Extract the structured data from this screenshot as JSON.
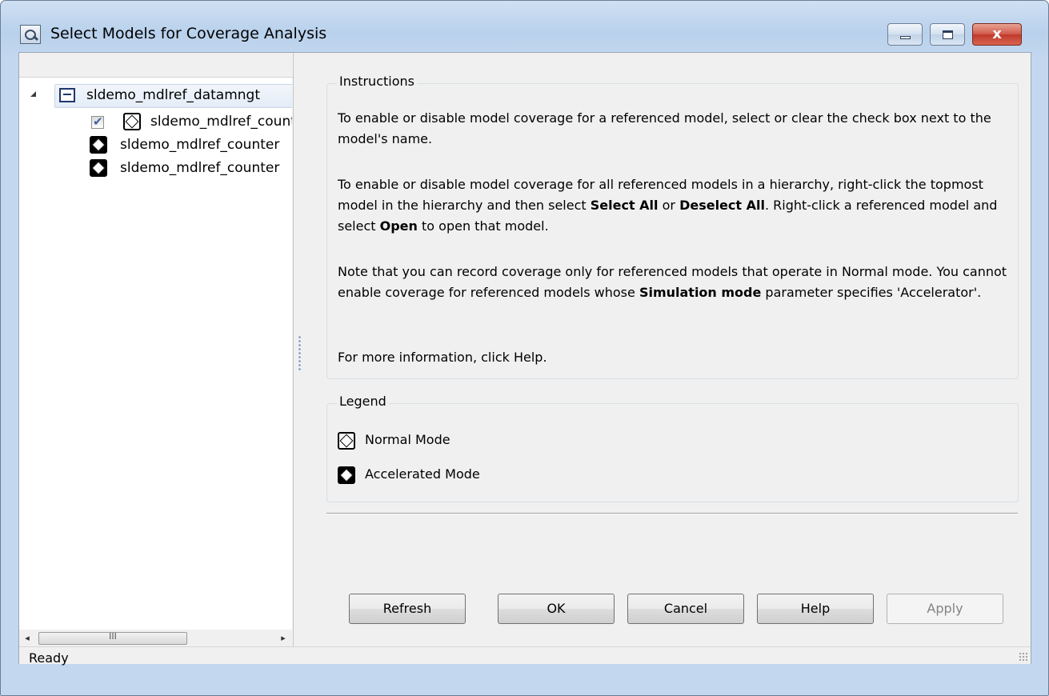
{
  "window": {
    "title": "Select Models for Coverage Analysis",
    "close_glyph": "x"
  },
  "tree": {
    "root": {
      "label": "sldemo_mdlref_datamngt",
      "icon": "subsystem-icon",
      "expanded": true
    },
    "children": [
      {
        "label": "sldemo_mdlref_counter",
        "icon": "normal-mode-icon",
        "checked": true
      },
      {
        "label": "sldemo_mdlref_counter",
        "icon": "accelerated-mode-icon"
      },
      {
        "label": "sldemo_mdlref_counter",
        "icon": "accelerated-mode-icon"
      }
    ]
  },
  "scrollbar": {
    "left_arrow": "◂",
    "right_arrow": "▸",
    "grip": "III"
  },
  "instructions": {
    "title": "Instructions",
    "p1": "To enable or disable model coverage for a referenced model, select or clear the check box next to the model's name.",
    "p2_a": "To enable or disable model coverage for all referenced models in a hierarchy, right-click the topmost model in the hierarchy and then select ",
    "p2_b1": "Select All",
    "p2_c": " or ",
    "p2_b2": "Deselect All",
    "p2_d": ". Right-click a referenced model and select ",
    "p2_b3": "Open",
    "p2_e": " to open that model.",
    "p3_a": "Note that you can record coverage only for referenced models that operate in Normal mode. You cannot enable coverage for referenced models whose ",
    "p3_b": "Simulation mode",
    "p3_c": " parameter specifies 'Accelerator'.",
    "p4": "For more information, click Help."
  },
  "legend": {
    "title": "Legend",
    "normal": "Normal Mode",
    "accelerated": "Accelerated Mode"
  },
  "buttons": {
    "refresh": "Refresh",
    "ok": "OK",
    "cancel": "Cancel",
    "help": "Help",
    "apply": "Apply"
  },
  "status": "Ready",
  "colors": {
    "title_gradient": "#b9d1ec",
    "close_button": "#c0392b",
    "selection": "#e3ecf7",
    "check": "#4060a0"
  }
}
